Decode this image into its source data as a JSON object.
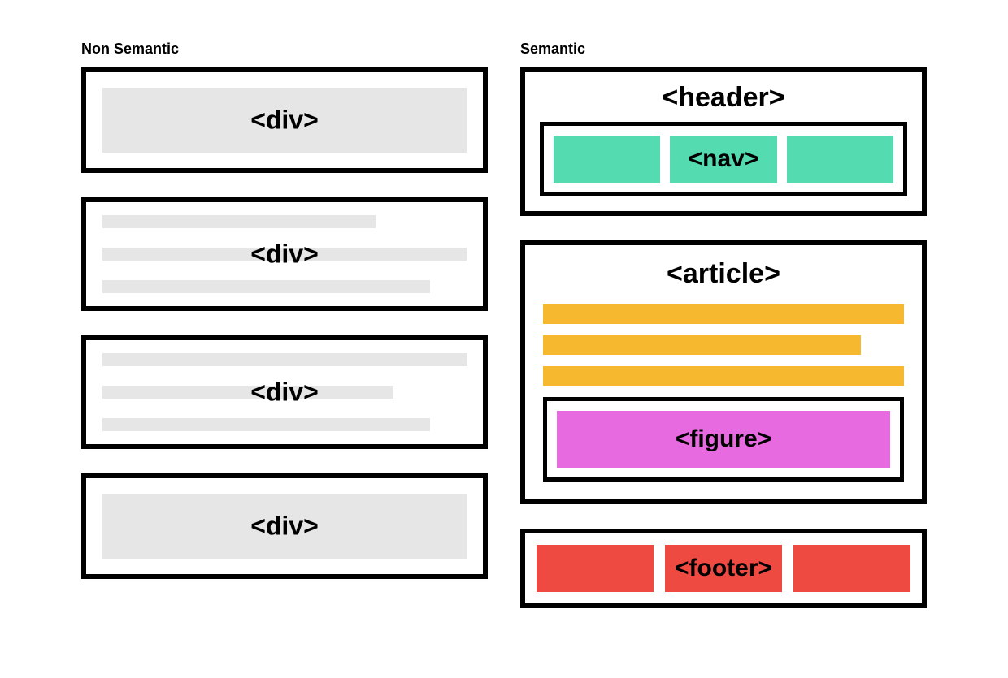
{
  "columns": {
    "left": {
      "title": "Non Semantic",
      "boxes": [
        {
          "label": "<div>"
        },
        {
          "label": "<div>"
        },
        {
          "label": "<div>"
        },
        {
          "label": "<div>"
        }
      ]
    },
    "right": {
      "title": "Semantic",
      "header": {
        "label": "<header>",
        "nav": {
          "label": "<nav>"
        }
      },
      "article": {
        "label": "<article>",
        "figure": {
          "label": "<figure>"
        }
      },
      "footer": {
        "label": "<footer>"
      }
    }
  },
  "colors": {
    "border": "#000000",
    "gray_fill": "#e6e6e6",
    "nav_green": "#54dbaf",
    "article_yellow": "#f5b82e",
    "figure_magenta": "#e86ae1",
    "footer_red": "#ef4a42"
  }
}
